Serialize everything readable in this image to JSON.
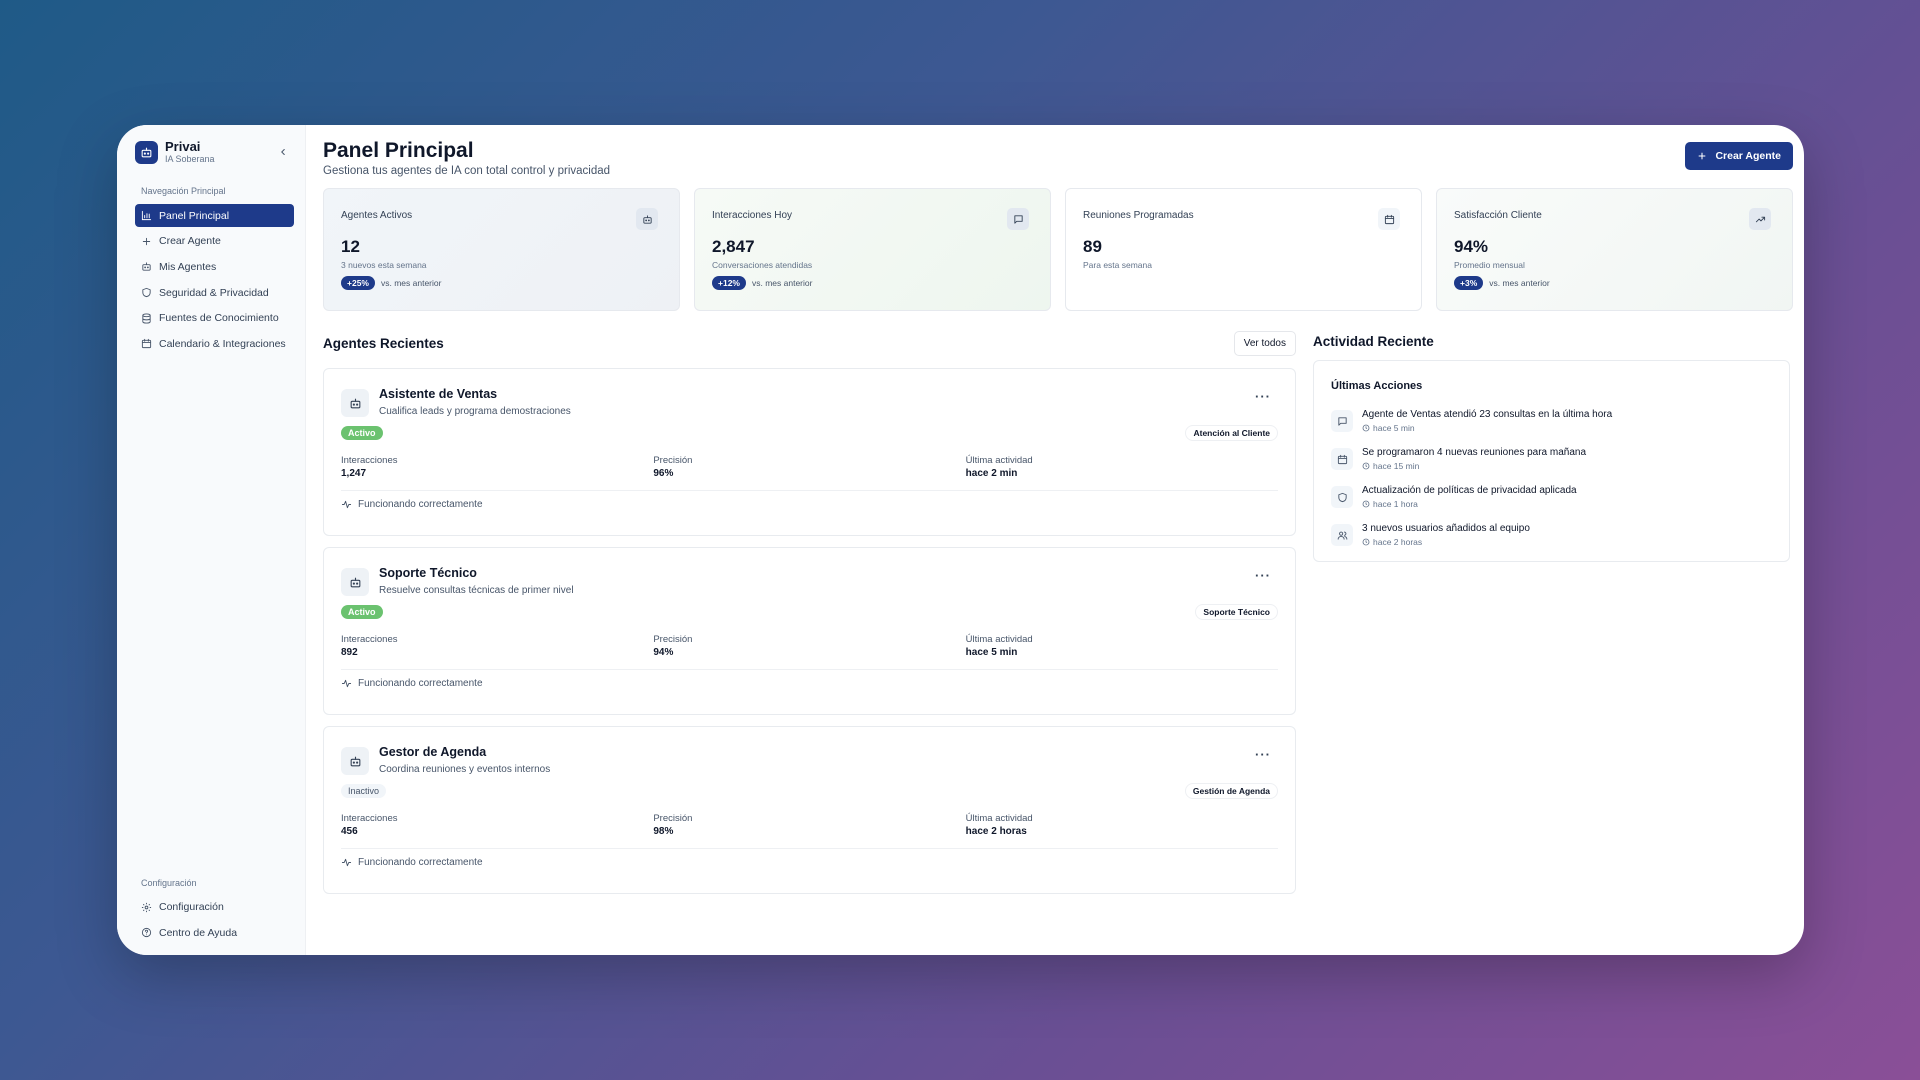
{
  "brand": {
    "name": "Privai",
    "subtitle": "IA Soberana"
  },
  "sidebar": {
    "nav_label": "Navegación Principal",
    "items": [
      {
        "label": "Panel Principal",
        "icon": "bar-chart-icon",
        "active": true
      },
      {
        "label": "Crear Agente",
        "icon": "plus-icon"
      },
      {
        "label": "Mis Agentes",
        "icon": "bot-icon"
      },
      {
        "label": "Seguridad & Privacidad",
        "icon": "shield-icon"
      },
      {
        "label": "Fuentes de Conocimiento",
        "icon": "database-icon"
      },
      {
        "label": "Calendario & Integraciones",
        "icon": "calendar-icon"
      }
    ],
    "config_label": "Configuración",
    "config_items": [
      {
        "label": "Configuración",
        "icon": "gear-icon"
      },
      {
        "label": "Centro de Ayuda",
        "icon": "help-icon"
      }
    ]
  },
  "header": {
    "title": "Panel Principal",
    "subtitle": "Gestiona tus agentes de IA con total control y privacidad",
    "create_button": "Crear Agente"
  },
  "stats": [
    {
      "title": "Agentes Activos",
      "value": "12",
      "desc": "3 nuevos esta semana",
      "change": "+25%",
      "change_text": "vs. mes anterior",
      "icon": "bot-icon"
    },
    {
      "title": "Interacciones Hoy",
      "value": "2,847",
      "desc": "Conversaciones atendidas",
      "change": "+12%",
      "change_text": "vs. mes anterior",
      "icon": "message-icon"
    },
    {
      "title": "Reuniones Programadas",
      "value": "89",
      "desc": "Para esta semana",
      "icon": "calendar-icon"
    },
    {
      "title": "Satisfacción Cliente",
      "value": "94%",
      "desc": "Promedio mensual",
      "change": "+3%",
      "change_text": "vs. mes anterior",
      "icon": "trending-up-icon"
    }
  ],
  "agents_section": {
    "title": "Agentes Recientes",
    "view_all": "Ver todos",
    "metric_labels": {
      "interactions": "Interacciones",
      "precision": "Precisión",
      "last_activity": "Última actividad"
    },
    "agents": [
      {
        "name": "Asistente de Ventas",
        "desc": "Cualifica leads y programa demostraciones",
        "status": "Activo",
        "category": "Atención al Cliente",
        "interactions": "1,247",
        "precision": "96%",
        "last_activity": "hace 2 min",
        "footer": "Funcionando correctamente"
      },
      {
        "name": "Soporte Técnico",
        "desc": "Resuelve consultas técnicas de primer nivel",
        "status": "Activo",
        "category": "Soporte Técnico",
        "interactions": "892",
        "precision": "94%",
        "last_activity": "hace 5 min",
        "footer": "Funcionando correctamente"
      },
      {
        "name": "Gestor de Agenda",
        "desc": "Coordina reuniones y eventos internos",
        "status": "Inactivo",
        "category": "Gestión de Agenda",
        "interactions": "456",
        "precision": "98%",
        "last_activity": "hace 2 horas",
        "footer": "Funcionando correctamente"
      }
    ]
  },
  "activity": {
    "title": "Actividad Reciente",
    "subtitle": "Últimas Acciones",
    "items": [
      {
        "text": "Agente de Ventas atendió 23 consultas en la última hora",
        "time": "hace 5 min",
        "icon": "message-icon"
      },
      {
        "text": "Se programaron 4 nuevas reuniones para mañana",
        "time": "hace 15 min",
        "icon": "calendar-icon"
      },
      {
        "text": "Actualización de políticas de privacidad aplicada",
        "time": "hace 1 hora",
        "icon": "shield-icon"
      },
      {
        "text": "3 nuevos usuarios añadidos al equipo",
        "time": "hace 2 horas",
        "icon": "users-icon"
      }
    ]
  },
  "colors": {
    "primary": "#1e3a8a",
    "active_badge": "#6bc26f"
  }
}
